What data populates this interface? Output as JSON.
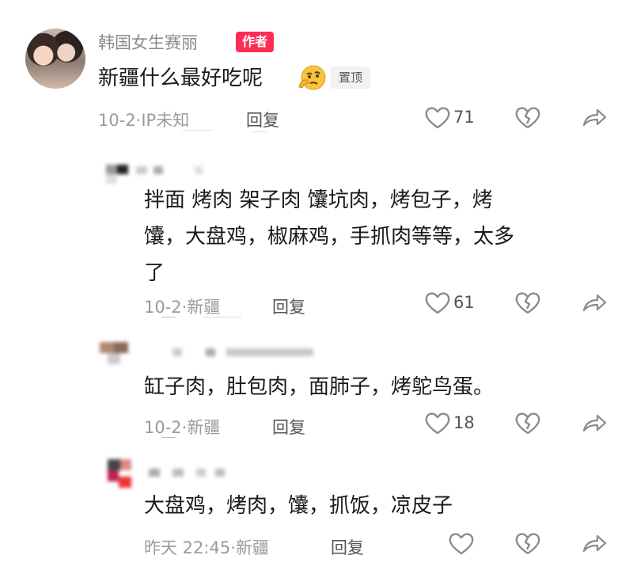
{
  "author": {
    "name": "韩国女生赛丽",
    "badge": "作者",
    "comment": "新疆什么最好吃呢",
    "pin": "置顶",
    "meta": "10-2·IP未知",
    "reply": "回复",
    "likes": "71"
  },
  "replies": [
    {
      "lines": [
        "拌面 烤肉  架子肉  馕坑肉，烤包子，烤",
        "馕，大盘鸡，椒麻鸡，手抓肉等等，太多",
        "了"
      ],
      "meta": "10-2·新疆",
      "reply": "回复",
      "likes": "61"
    },
    {
      "lines": [
        "缸子肉，肚包肉，面肺子，烤鸵鸟蛋。"
      ],
      "meta": "10-2·新疆",
      "reply": "回复",
      "likes": "18"
    },
    {
      "lines": [
        "大盘鸡，烤肉，馕，抓饭，凉皮子"
      ],
      "meta": "昨天 22:45·新疆",
      "reply": "回复",
      "likes": ""
    }
  ],
  "icons": {
    "like": "heart-outline-icon",
    "dislike": "broken-heart-icon",
    "share": "share-arrow-icon"
  },
  "colors": {
    "badge": "#fe2c55",
    "meta": "#9a9a9f",
    "text": "#1a1a1a"
  }
}
